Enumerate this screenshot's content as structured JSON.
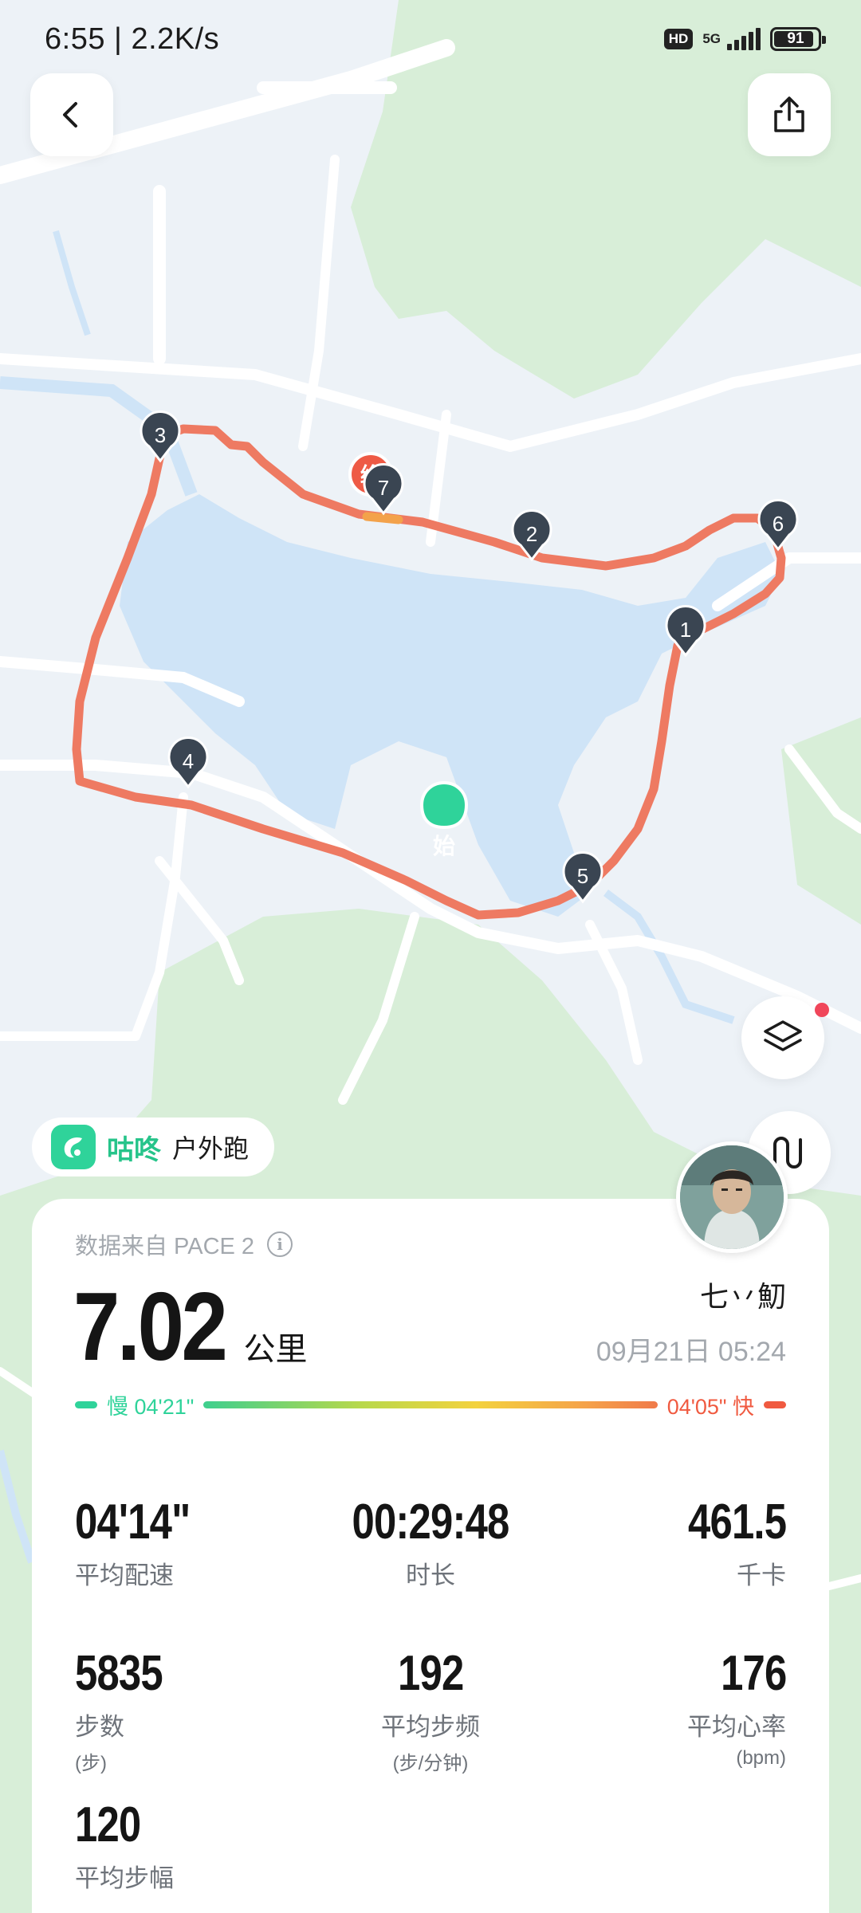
{
  "status_bar": {
    "time_speed": "6:55 | 2.2K/s",
    "hd": "HD",
    "network": "5G",
    "battery": "91",
    "battery_level": 0.91
  },
  "map": {
    "start_marker": "始",
    "end_marker": "终",
    "km_markers": [
      "1",
      "2",
      "3",
      "4",
      "5",
      "6",
      "7"
    ],
    "route_color": "#ee7a62",
    "water_color": "#cfe5f8",
    "park_color": "#d9efd9"
  },
  "controls": {
    "back_icon": "chevron-left-icon",
    "share_icon": "share-icon",
    "layers_icon": "layers-icon",
    "route_mode_icon": "route-icon",
    "notification_color": "#f0465a"
  },
  "app": {
    "brand": "咕咚",
    "activity": "户外跑",
    "brand_color": "#2fd39a"
  },
  "summary": {
    "source": "数据来自 PACE 2",
    "distance": "7.02",
    "distance_unit": "公里",
    "user_name": "七丷魛",
    "date": "09月21日 05:24",
    "pace_slow": "慢 04'21\"",
    "pace_fast": "04'05\" 快"
  },
  "stats": [
    [
      {
        "value": "04'14\"",
        "label": "平均配速"
      },
      {
        "value": "00:29:48",
        "label": "时长"
      },
      {
        "value": "461.5",
        "label": "千卡"
      }
    ],
    [
      {
        "value": "5835",
        "label": "步数",
        "sub": "(步)"
      },
      {
        "value": "192",
        "label": "平均步频",
        "sub": "(步/分钟)"
      },
      {
        "value": "176",
        "label": "平均心率",
        "sub": "(bpm)"
      }
    ],
    [
      {
        "value": "120",
        "label": "平均步幅"
      }
    ]
  ]
}
